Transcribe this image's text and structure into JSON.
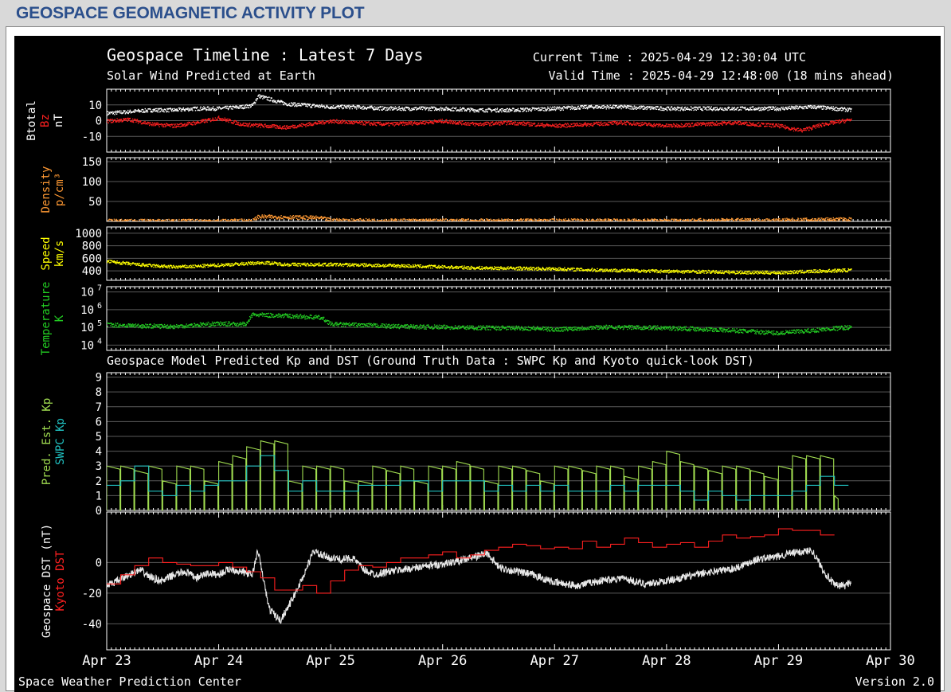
{
  "page_title": "GEOSPACE GEOMAGNETIC ACTIVITY PLOT",
  "header": {
    "title": "Geospace Timeline : Latest 7 Days",
    "subtitle": "Solar Wind Predicted at Earth",
    "current_time": "Current Time : 2025-04-29 12:30:04 UTC",
    "valid_time": "Valid Time : 2025-04-29 12:48:00 (18 mins ahead)",
    "model_title": "Geospace Model Predicted Kp and DST (Ground Truth Data : SWPC Kp and Kyoto quick-look DST)"
  },
  "footer": {
    "left": "Space Weather Prediction Center",
    "right": "Version 2.0"
  },
  "colors": {
    "btotal": "#ffffff",
    "bz": "#ff2020",
    "density": "#ff9933",
    "speed": "#ffff00",
    "temperature": "#22cc22",
    "pred_kp": "#a0dc50",
    "swpc_kp": "#20c0c0",
    "geo_dst": "#e8e8e8",
    "kyoto_dst": "#ff2020"
  },
  "chart_data": [
    {
      "type": "scatter",
      "panel": "magnetic-field",
      "ylabels": [
        {
          "text": "Btotal",
          "color": "#ffffff"
        },
        {
          "text": "Bz",
          "color": "#ff2020"
        },
        {
          "text": "nT",
          "color": "#ffffff"
        }
      ],
      "ylim": [
        -20,
        20
      ],
      "yticks": [
        {
          "v": 10,
          "label": "10"
        },
        {
          "v": 0,
          "label": "0"
        },
        {
          "v": -10,
          "label": "-10"
        }
      ],
      "series": [
        {
          "name": "Btotal",
          "x": [
            23.0,
            23.2,
            23.4,
            23.6,
            23.8,
            24.0,
            24.2,
            24.3,
            24.35,
            24.5,
            24.6,
            24.8,
            25.0,
            25.2,
            25.5,
            25.8,
            26.0,
            26.3,
            26.6,
            27.0,
            27.3,
            27.6,
            28.0,
            28.3,
            28.6,
            29.0,
            29.3,
            29.5,
            29.65
          ],
          "y": [
            5,
            6,
            7,
            7,
            8,
            8,
            9,
            10,
            16,
            13,
            11,
            10,
            9,
            9,
            8,
            8,
            8,
            7,
            7,
            8,
            9,
            9,
            8,
            8,
            8,
            8,
            9,
            8,
            7
          ]
        },
        {
          "name": "Bz",
          "x": [
            23.0,
            23.2,
            23.4,
            23.6,
            23.8,
            24.0,
            24.2,
            24.4,
            24.6,
            24.8,
            25.0,
            25.2,
            25.5,
            25.8,
            26.0,
            26.3,
            26.6,
            27.0,
            27.3,
            27.6,
            28.0,
            28.3,
            28.6,
            29.0,
            29.2,
            29.4,
            29.65
          ],
          "y": [
            0,
            1,
            -2,
            -3,
            -1,
            2,
            -2,
            -3,
            -4,
            -2,
            0,
            -1,
            -2,
            -1,
            0,
            -2,
            -1,
            -3,
            -2,
            -1,
            -3,
            -2,
            -1,
            -3,
            -6,
            -2,
            1
          ]
        }
      ]
    },
    {
      "type": "scatter",
      "panel": "density",
      "ylabels": [
        {
          "text": "Density",
          "color": "#ff9933"
        },
        {
          "text": "p/cm³",
          "color": "#ff9933"
        }
      ],
      "ylim": [
        0,
        160
      ],
      "yticks": [
        {
          "v": 150,
          "label": "150"
        },
        {
          "v": 100,
          "label": "100"
        },
        {
          "v": 50,
          "label": "50"
        }
      ],
      "series": [
        {
          "name": "Density",
          "x": [
            23.0,
            23.5,
            24.0,
            24.3,
            24.35,
            24.6,
            24.9,
            25.0,
            25.5,
            26.0,
            26.5,
            27.0,
            27.5,
            28.0,
            28.5,
            29.0,
            29.5,
            29.65
          ],
          "y": [
            2,
            2,
            2,
            3,
            13,
            12,
            10,
            4,
            3,
            3,
            3,
            3,
            3,
            3,
            4,
            4,
            6,
            6
          ]
        }
      ]
    },
    {
      "type": "scatter",
      "panel": "speed",
      "ylabels": [
        {
          "text": "Speed",
          "color": "#ffff00"
        },
        {
          "text": "km/s",
          "color": "#ffff00"
        }
      ],
      "ylim": [
        250,
        1100
      ],
      "yticks": [
        {
          "v": 1000,
          "label": "1000"
        },
        {
          "v": 800,
          "label": "800"
        },
        {
          "v": 600,
          "label": "600"
        },
        {
          "v": 400,
          "label": "400"
        }
      ],
      "series": [
        {
          "name": "Speed",
          "x": [
            23.0,
            23.2,
            23.4,
            23.6,
            23.8,
            24.0,
            24.2,
            24.4,
            24.6,
            25.0,
            25.3,
            25.6,
            26.0,
            26.3,
            26.6,
            27.0,
            27.3,
            27.6,
            28.0,
            28.3,
            28.6,
            29.0,
            29.3,
            29.65
          ],
          "y": [
            560,
            520,
            490,
            470,
            480,
            500,
            520,
            540,
            510,
            510,
            500,
            490,
            470,
            455,
            450,
            440,
            425,
            415,
            400,
            395,
            385,
            380,
            400,
            420
          ]
        }
      ]
    },
    {
      "type": "scatter",
      "panel": "temperature",
      "log_scale": true,
      "ylabels": [
        {
          "text": "Temperature",
          "color": "#22cc22"
        },
        {
          "text": "K",
          "color": "#22cc22"
        }
      ],
      "ylim": [
        5000,
        20000000
      ],
      "yticks": [
        {
          "v": 10000000,
          "label": "10",
          "exp": "7"
        },
        {
          "v": 1000000,
          "label": "10",
          "exp": "6"
        },
        {
          "v": 100000,
          "label": "10",
          "exp": "5"
        },
        {
          "v": 10000,
          "label": "10",
          "exp": "4"
        }
      ],
      "series": [
        {
          "name": "Temperature",
          "x": [
            23.0,
            23.3,
            23.6,
            24.0,
            24.25,
            24.3,
            24.6,
            24.9,
            25.0,
            25.3,
            25.6,
            26.0,
            26.4,
            26.8,
            27.0,
            27.4,
            27.8,
            28.2,
            28.5,
            28.8,
            29.0,
            29.3,
            29.65
          ],
          "y": [
            150000,
            130000,
            120000,
            170000,
            160000,
            550000,
            480000,
            380000,
            160000,
            140000,
            120000,
            110000,
            100000,
            95000,
            80000,
            110000,
            105000,
            90000,
            75000,
            60000,
            50000,
            70000,
            110000
          ]
        }
      ]
    },
    {
      "type": "line",
      "panel": "kp",
      "ylabels": [
        {
          "text": "Pred. Est. Kp",
          "color": "#a0dc50"
        },
        {
          "text": "SWPC Kp",
          "color": "#20c0c0"
        }
      ],
      "ylim": [
        0,
        9.3
      ],
      "yticks": [
        {
          "v": 9,
          "label": "9"
        },
        {
          "v": 8,
          "label": "8"
        },
        {
          "v": 7,
          "label": "7"
        },
        {
          "v": 6,
          "label": "6"
        },
        {
          "v": 5,
          "label": "5"
        },
        {
          "v": 4,
          "label": "4"
        },
        {
          "v": 3,
          "label": "3"
        },
        {
          "v": 2,
          "label": "2"
        },
        {
          "v": 1,
          "label": "1"
        },
        {
          "v": 0,
          "label": "0"
        }
      ],
      "series": [
        {
          "name": "Pred. Est. Kp",
          "style": "sawtooth",
          "x": [
            23.0,
            23.125,
            23.25,
            23.375,
            23.5,
            23.625,
            23.75,
            23.875,
            24.0,
            24.125,
            24.25,
            24.375,
            24.5,
            24.625,
            24.75,
            24.875,
            25.0,
            25.125,
            25.25,
            25.375,
            25.5,
            25.625,
            25.75,
            25.875,
            26.0,
            26.125,
            26.25,
            26.375,
            26.5,
            26.625,
            26.75,
            26.875,
            27.0,
            27.125,
            27.25,
            27.375,
            27.5,
            27.625,
            27.75,
            27.875,
            28.0,
            28.125,
            28.25,
            28.375,
            28.5,
            28.625,
            28.75,
            28.875,
            29.0,
            29.125,
            29.25,
            29.375,
            29.5
          ],
          "y": [
            3,
            3,
            2.7,
            3,
            2,
            3,
            3,
            2,
            3.3,
            3.7,
            4.3,
            4.7,
            4.7,
            2,
            3,
            3,
            3,
            2,
            2,
            3,
            2.7,
            3,
            2,
            3,
            3,
            3.3,
            3,
            2,
            3,
            3,
            2.7,
            2,
            3,
            3,
            2.7,
            3,
            3,
            2.3,
            3,
            3.3,
            4,
            3.3,
            3,
            2.7,
            3,
            3,
            2.7,
            2.3,
            3,
            3.7,
            3.7,
            3.7,
            1
          ]
        },
        {
          "name": "SWPC Kp",
          "style": "step",
          "x": [
            23.0,
            23.125,
            23.25,
            23.375,
            23.5,
            23.625,
            23.75,
            23.875,
            24.0,
            24.125,
            24.25,
            24.375,
            24.5,
            24.625,
            24.75,
            24.875,
            25.0,
            25.125,
            25.25,
            25.375,
            25.5,
            25.625,
            25.75,
            25.875,
            26.0,
            26.125,
            26.25,
            26.375,
            26.5,
            26.625,
            26.75,
            26.875,
            27.0,
            27.125,
            27.25,
            27.375,
            27.5,
            27.625,
            27.75,
            27.875,
            28.0,
            28.125,
            28.25,
            28.375,
            28.5,
            28.625,
            28.75,
            28.875,
            29.0,
            29.125,
            29.25,
            29.375,
            29.5
          ],
          "y": [
            1.7,
            2,
            3,
            1.3,
            1,
            1.7,
            1.3,
            1.7,
            2,
            2,
            3,
            3.7,
            2.7,
            1.3,
            2,
            1.3,
            1.3,
            1.3,
            1.7,
            1.7,
            1.7,
            2,
            2,
            1.3,
            2,
            2,
            2,
            1.3,
            1.7,
            1.3,
            1.7,
            1.3,
            1.7,
            1.3,
            1.3,
            1.3,
            1.7,
            1.3,
            1.7,
            1.7,
            1.7,
            1.3,
            0.7,
            1.3,
            1,
            0.7,
            1,
            1,
            1,
            1.3,
            1.7,
            2.3,
            1.7
          ]
        }
      ]
    },
    {
      "type": "line",
      "panel": "dst",
      "ylabels": [
        {
          "text": "Geospace DST (nT)",
          "color": "#ffffff"
        },
        {
          "text": "Kyoto DST",
          "color": "#ff2020"
        }
      ],
      "ylim": [
        -57,
        33
      ],
      "yticks": [
        {
          "v": 0,
          "label": "0"
        },
        {
          "v": -20,
          "label": "-20"
        },
        {
          "v": -40,
          "label": "-40"
        }
      ],
      "xticks": [
        "Apr 23",
        "Apr 24",
        "Apr 25",
        "Apr 26",
        "Apr 27",
        "Apr 28",
        "Apr 29",
        "Apr 30"
      ],
      "xlim": [
        23,
        30
      ],
      "series": [
        {
          "name": "Geospace DST",
          "style": "noisy",
          "x": [
            23.0,
            23.1,
            23.2,
            23.3,
            23.4,
            23.5,
            23.6,
            23.7,
            23.8,
            23.9,
            24.0,
            24.1,
            24.2,
            24.3,
            24.35,
            24.45,
            24.55,
            24.65,
            24.75,
            24.85,
            24.9,
            25.0,
            25.1,
            25.2,
            25.3,
            25.4,
            25.5,
            25.7,
            25.9,
            26.0,
            26.2,
            26.4,
            26.5,
            26.6,
            26.8,
            27.0,
            27.2,
            27.4,
            27.6,
            27.8,
            28.0,
            28.2,
            28.4,
            28.6,
            28.8,
            29.0,
            29.1,
            29.2,
            29.3,
            29.4,
            29.5,
            29.6,
            29.65
          ],
          "y": [
            -15,
            -12,
            -8,
            -5,
            -10,
            -12,
            -8,
            -6,
            -10,
            -7,
            -8,
            -4,
            -6,
            -8,
            8,
            -30,
            -38,
            -25,
            -10,
            8,
            5,
            3,
            2,
            3,
            -5,
            -8,
            -6,
            -4,
            -2,
            -1,
            2,
            6,
            -3,
            -5,
            -8,
            -13,
            -15,
            -12,
            -10,
            -14,
            -12,
            -9,
            -6,
            -4,
            2,
            4,
            6,
            7,
            8,
            -5,
            -15,
            -15,
            -12
          ]
        },
        {
          "name": "Kyoto DST",
          "style": "step",
          "x": [
            23.0,
            23.125,
            23.25,
            23.375,
            23.5,
            23.625,
            23.75,
            23.875,
            24.0,
            24.125,
            24.25,
            24.375,
            24.5,
            24.625,
            24.75,
            24.875,
            25.0,
            25.125,
            25.25,
            25.375,
            25.5,
            25.625,
            25.75,
            25.875,
            26.0,
            26.125,
            26.25,
            26.375,
            26.5,
            26.625,
            26.75,
            26.875,
            27.0,
            27.125,
            27.25,
            27.375,
            27.5,
            27.625,
            27.75,
            27.875,
            28.0,
            28.125,
            28.25,
            28.375,
            28.5,
            28.625,
            28.75,
            28.875,
            29.0,
            29.125,
            29.25,
            29.375
          ],
          "y": [
            -14,
            -8,
            -2,
            3,
            0,
            -1,
            -2,
            -2,
            0,
            -3,
            -6,
            -10,
            -18,
            -18,
            -15,
            -20,
            -12,
            -5,
            -2,
            -3,
            0,
            3,
            3,
            5,
            7,
            3,
            5,
            8,
            10,
            12,
            11,
            9,
            10,
            9,
            14,
            10,
            12,
            16,
            13,
            10,
            12,
            13,
            10,
            14,
            18,
            16,
            17,
            18,
            22,
            21,
            21,
            18
          ]
        }
      ]
    }
  ]
}
